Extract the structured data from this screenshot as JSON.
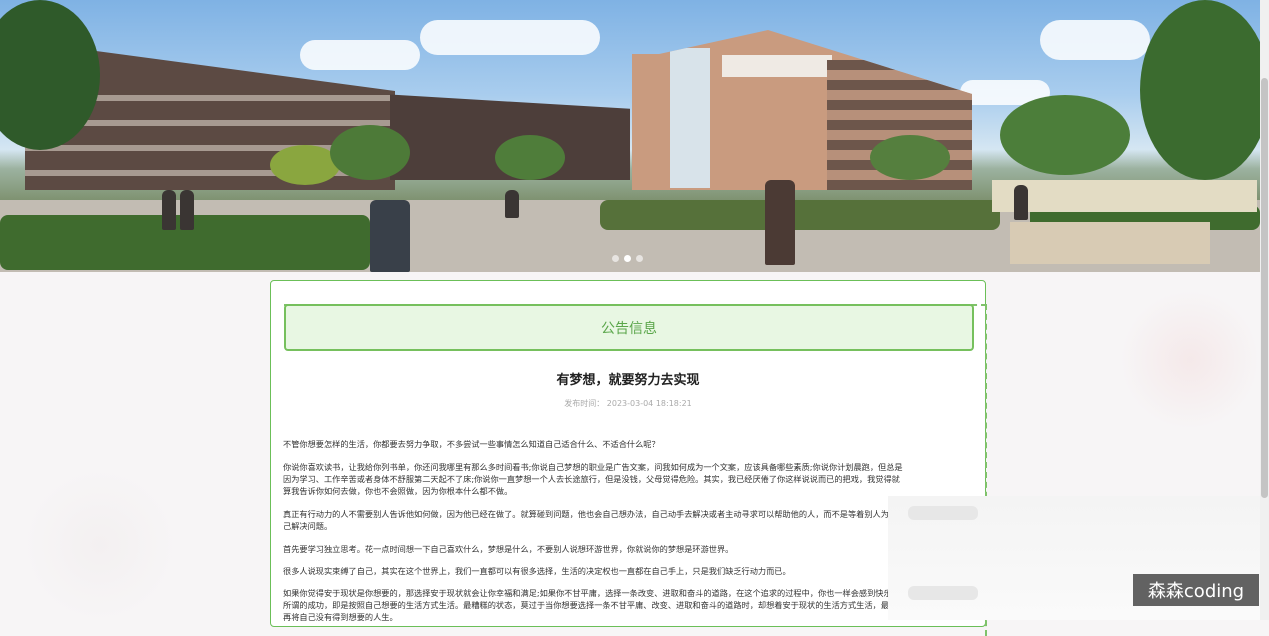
{
  "banner": {
    "slides": [
      "slide-1",
      "slide-2",
      "slide-3"
    ],
    "active_slide": 2
  },
  "notice": {
    "heading": "公告信息",
    "title": "有梦想，就要努力去实现",
    "publish_label": "发布时间：",
    "publish_time": "2023-03-04 18:18:21",
    "paragraphs": [
      "不管你想要怎样的生活，你都要去努力争取，不多尝试一些事情怎么知道自己适合什么、不适合什么呢？",
      "你说你喜欢读书，让我给你列书单，你还问我哪里有那么多时间看书;你说自己梦想的职业是广告文案，问我如何成为一个文案，应该具备哪些素质;你说你计划晨跑，但总是因为学习、工作辛苦或者身体不舒服第二天起不了床;你说你一直梦想一个人去长途旅行，但是没钱，父母觉得危险。其实，我已经厌倦了你这样说说而已的把戏，我觉得就算我告诉你如何去做，你也不会照做，因为你根本什么都不做。",
      "真正有行动力的人不需要别人告诉他如何做，因为他已经在做了。就算碰到问题，他也会自己想办法，自己动手去解决或者主动寻求可以帮助他的人，而不是等着别人为自己解决问题。",
      "首先要学习独立思考。花一点时间想一下自己喜欢什么，梦想是什么，不要别人说想环游世界，你就说你的梦想是环游世界。",
      "很多人说现实束缚了自己，其实在这个世界上，我们一直都可以有很多选择，生活的决定权也一直都在自己手上，只是我们缺乏行动力而已。",
      "如果你觉得安于现状是你想要的，那选择安于现状就会让你幸福和满足;如果你不甘平庸，选择一条改变、进取和奋斗的道路，在这个追求的过程中，你也一样会感到快乐。所谓的成功，即是按照自己想要的生活方式生活。最糟糕的状态，莫过于当你想要选择一条不甘平庸、改变、进取和奋斗的道路时，却想着安于现状的生活方式生活，最后再将自己没有得到想要的人生。"
    ]
  },
  "watermark": "森森coding"
}
